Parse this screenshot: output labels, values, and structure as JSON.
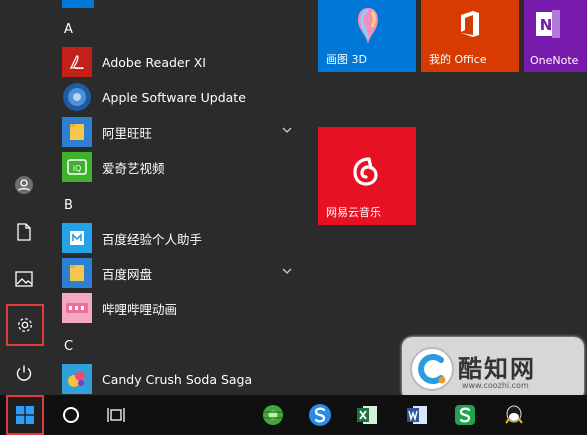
{
  "apps": {
    "letter_a": "A",
    "adobe": "Adobe Reader XI",
    "apple_update": "Apple Software Update",
    "aliwangwang": "阿里旺旺",
    "iqiyi": "爱奇艺视频",
    "letter_b": "B",
    "baidu_assistant": "百度经验个人助手",
    "baidu_pan": "百度网盘",
    "bilibili": "哔哩哔哩动画",
    "letter_c": "C",
    "candy_crush": "Candy Crush Soda Saga"
  },
  "tiles": {
    "paint3d": "画图 3D",
    "office": "我的 Office",
    "onenote": "OneNote",
    "netease_music": "网易云音乐"
  },
  "watermark": {
    "name": "酷知网",
    "url": "www.coozhi.com"
  },
  "icons": {
    "rail": [
      "user-icon",
      "document-icon",
      "pictures-icon",
      "settings-icon",
      "power-icon"
    ],
    "taskbar": [
      "windows-start-icon",
      "cortana-icon",
      "task-view-icon",
      "browser-icon",
      "sogou-icon",
      "excel-icon",
      "word-icon",
      "sheets-icon",
      "qq-icon"
    ]
  },
  "colors": {
    "paint3d_tile": "#0078d7",
    "office_tile": "#d83b01",
    "onenote_tile": "#7719aa",
    "netease_tile": "#e81123",
    "highlight": "#e03a3a"
  }
}
